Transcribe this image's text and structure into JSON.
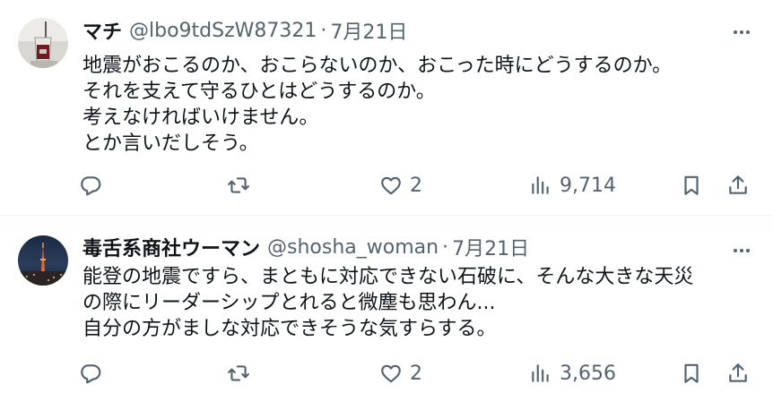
{
  "tweets": [
    {
      "name": "マチ",
      "handle": "@lbo9tdSzW87321",
      "separator": "·",
      "date": "7月21日",
      "lines": [
        "地震がおこるのか、おこらないのか、おこった時にどうするのか。",
        "それを支えて守るひとはどうするのか。",
        "考えなければいけません。",
        "とか言いだしそう。"
      ],
      "reply_count": "",
      "retweet_count": "",
      "like_count": "2",
      "view_count": "9,714",
      "avatar_icon": "glass-cup-photo"
    },
    {
      "name": "毒舌系商社ウーマン",
      "handle": "@shosha_woman",
      "separator": "·",
      "date": "7月21日",
      "lines": [
        "能登の地震ですら、まともに対応できない石破に、そんな大きな天災",
        "の際にリーダーシップとれると微塵も思わん...",
        "自分の方がましな対応できそうな気すらする。"
      ],
      "reply_count": "",
      "retweet_count": "",
      "like_count": "2",
      "view_count": "3,656",
      "avatar_icon": "tokyo-tower-night-photo"
    }
  ],
  "colors": {
    "text": "#0f1419",
    "secondary": "#536471",
    "divider": "#eff3f4"
  },
  "icons": [
    "more-icon",
    "reply-icon",
    "retweet-icon",
    "like-icon",
    "views-icon",
    "bookmark-icon",
    "share-icon"
  ]
}
